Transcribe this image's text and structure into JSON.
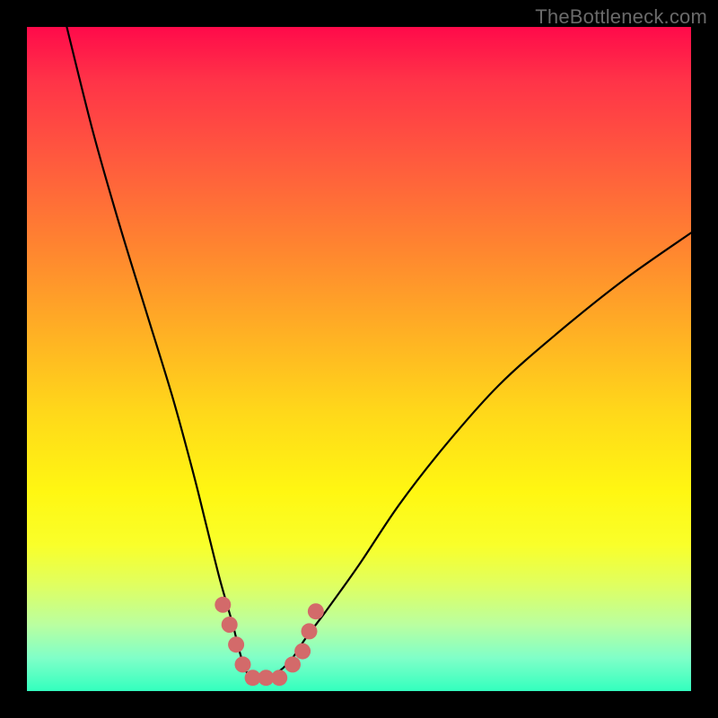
{
  "watermark": "TheBottleneck.com",
  "chart_data": {
    "type": "line",
    "title": "",
    "xlabel": "",
    "ylabel": "",
    "xlim": [
      0,
      100
    ],
    "ylim": [
      0,
      100
    ],
    "series": [
      {
        "name": "bottleneck-curve",
        "x": [
          6,
          10,
          14,
          18,
          22,
          25,
          27,
          29,
          31,
          32,
          33,
          34,
          36,
          38,
          40,
          42,
          45,
          50,
          56,
          63,
          71,
          80,
          90,
          100
        ],
        "values": [
          100,
          84,
          70,
          57,
          44,
          33,
          25,
          17,
          10,
          6,
          3,
          2,
          2,
          3,
          5,
          8,
          12,
          19,
          28,
          37,
          46,
          54,
          62,
          69
        ]
      }
    ],
    "highlight": {
      "name": "highlight-dots",
      "color": "#d36a6a",
      "x": [
        29.5,
        30.5,
        31.5,
        32.5,
        34.0,
        36.0,
        38.0,
        40.0,
        41.5,
        42.5,
        43.5
      ],
      "values": [
        13,
        10,
        7,
        4,
        2,
        2,
        2,
        4,
        6,
        9,
        12
      ]
    }
  }
}
